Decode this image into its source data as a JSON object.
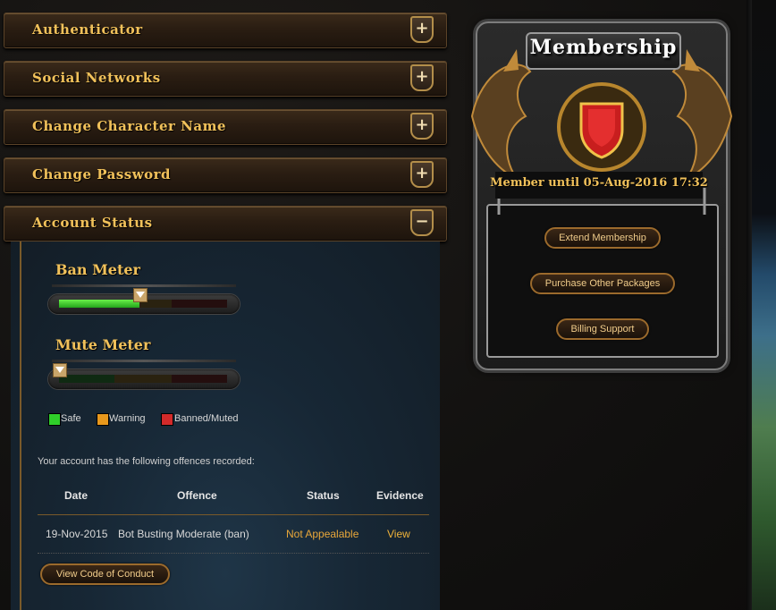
{
  "accordion": [
    {
      "label": "Authenticator",
      "toggle": "+"
    },
    {
      "label": "Social Networks",
      "toggle": "+"
    },
    {
      "label": "Change Character Name",
      "toggle": "+"
    },
    {
      "label": "Change Password",
      "toggle": "+"
    },
    {
      "label": "Account Status",
      "toggle": "−"
    }
  ],
  "account_status": {
    "ban_meter": {
      "title": "Ban Meter",
      "level_percent": 48
    },
    "mute_meter": {
      "title": "Mute Meter",
      "level_percent": 0
    },
    "legend": [
      {
        "label": "Safe",
        "color": "#2fcf2a"
      },
      {
        "label": "Warning",
        "color": "#e8981c"
      },
      {
        "label": "Banned/Muted",
        "color": "#d22a2a"
      }
    ],
    "offences_intro": "Your account has the following offences recorded:",
    "table": {
      "headers": [
        "Date",
        "Offence",
        "Status",
        "Evidence"
      ],
      "rows": [
        {
          "date": "19-Nov-2015",
          "offence": "Bot Busting Moderate (ban)",
          "status": "Not Appealable",
          "evidence": "View"
        }
      ]
    },
    "conduct_button": "View Code of Conduct"
  },
  "membership": {
    "title": "Membership",
    "member_until": "Member until 05-Aug-2016 17:32",
    "buttons": [
      "Extend Membership",
      "Purchase Other Packages",
      "Billing Support"
    ]
  },
  "colors": {
    "gold_text": "#f1c15a",
    "status_orange": "#e8a73a",
    "link_orange": "#f0b33a"
  }
}
